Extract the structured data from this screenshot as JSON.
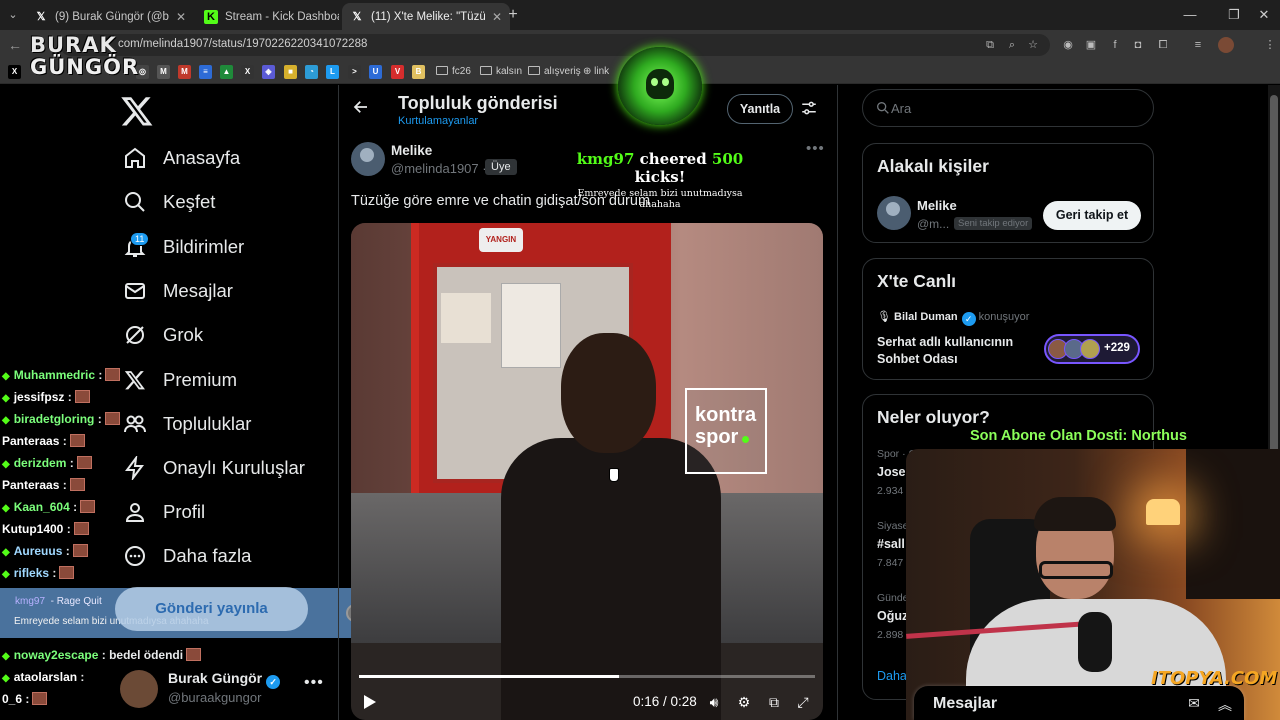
{
  "browser": {
    "tabs": [
      {
        "title": "(9) Burak Güngör (@buraakgungor)",
        "icon": "x-logo",
        "active": false
      },
      {
        "title": "Stream - Kick Dashboard",
        "icon": "kick-logo",
        "active": false
      },
      {
        "title": "(11) X'te Melike: \"Tüzüğe göre emre",
        "icon": "x-logo",
        "active": true
      }
    ],
    "url": "com/melinda1907/status/1970226220341072288",
    "bookmarks": [
      "fc26",
      "kalsın",
      "alışveriş",
      "link"
    ]
  },
  "overlay_logo": {
    "line1": "BURAK",
    "line2": "GÜNGÖR"
  },
  "nav": {
    "items": [
      {
        "label": "Anasayfa",
        "icon": "home-icon"
      },
      {
        "label": "Keşfet",
        "icon": "search-icon"
      },
      {
        "label": "Bildirimler",
        "icon": "bell-icon"
      },
      {
        "label": "Mesajlar",
        "icon": "mail-icon"
      },
      {
        "label": "Grok",
        "icon": "grok-icon"
      },
      {
        "label": "Premium",
        "icon": "x-icon"
      },
      {
        "label": "Topluluklar",
        "icon": "communities-icon"
      },
      {
        "label": "Onaylı Kuruluşlar",
        "icon": "lightning-icon"
      },
      {
        "label": "Profil",
        "icon": "user-icon"
      },
      {
        "label": "Daha fazla",
        "icon": "more-circle-icon"
      }
    ],
    "notif_count": "11",
    "post_button": "Gönderi yayınla"
  },
  "account": {
    "name": "Burak Güngör",
    "handle": "@buraakgungor",
    "more": "•••"
  },
  "stream_chat": {
    "lines": [
      {
        "user": "Muhammedric",
        "text": ":",
        "color": "#7cff7c",
        "diamond": true
      },
      {
        "user": "jessifpsz",
        "text": ":",
        "color": "#ffffff",
        "diamond": true
      },
      {
        "user": "biradetgloring",
        "text": ":",
        "color": "#7cff7c",
        "diamond": true
      },
      {
        "user": "Panteraas",
        "text": ":",
        "color": "#ffffff",
        "diamond": false
      },
      {
        "user": "derizdem",
        "text": ":",
        "color": "#7cff7c",
        "diamond": true
      },
      {
        "user": "Panteraas",
        "text": ":",
        "color": "#ffffff",
        "diamond": false
      },
      {
        "user": "Kaan_604",
        "text": ":",
        "color": "#7cff7c",
        "diamond": true
      },
      {
        "user": "Kutup1400",
        "text": ":",
        "color": "#ffffff",
        "diamond": false
      },
      {
        "user": "Aureuus",
        "text": ":",
        "color": "#a0d8ff",
        "diamond": true
      },
      {
        "user": "rifleks",
        "text": ":",
        "color": "#a0d8ff",
        "diamond": true
      }
    ],
    "lines_bottom": [
      {
        "user": "noway2escape",
        "text": ": bedel ödendi",
        "color": "#7cff7c",
        "diamond": true
      },
      {
        "user": "ataolarslan",
        "text": ":",
        "color": "#ffffff",
        "diamond": true
      },
      {
        "user": "0_6",
        "text": ":",
        "color": "#ffffff",
        "diamond": false
      }
    ],
    "alert": {
      "user": "kmg97",
      "separator": "-",
      "action": "Rage Quit",
      "message": "Emreyede selam bizi unutmadıysa ahahaha",
      "amount": "500"
    }
  },
  "cheer": {
    "user": "kmg97",
    "verb": "cheered",
    "amount": "500",
    "unit": "kicks!",
    "message": "Emreyede selam bizi unutmadıysa ahahaha"
  },
  "header": {
    "title": "Topluluk gönderisi",
    "subtitle": "Kurtulamayanlar",
    "reply": "Yanıtla"
  },
  "post": {
    "name": "Melike",
    "handle": "@melinda1907",
    "dot": "·",
    "member_badge": "Üye",
    "more": "•••",
    "text": "Tüzüğe göre emre ve chatin gidişat/son durum",
    "video": {
      "time": "0:16 / 0:28",
      "progress": 0.571,
      "logo_line1": "kontra",
      "logo_line2": "spor",
      "sign": "YANGIN"
    }
  },
  "right": {
    "search_placeholder": "Ara",
    "relevant": {
      "title": "Alakalı kişiler",
      "name": "Melike",
      "handle": "@m...",
      "follows_you": "Seni takip ediyor",
      "button": "Geri takip et"
    },
    "live": {
      "title": "X'te Canlı",
      "host": "Bilal Duman",
      "status": "konuşuyor",
      "space_title": "Serhat adlı kullanıcının Sohbet Odası",
      "listeners": "+229"
    },
    "trends": {
      "title": "Neler oluyor?",
      "items": [
        {
          "category": "Spor · Gündemdekiler",
          "name": "Jose M",
          "count": "2.934"
        },
        {
          "category": "Siyase",
          "name": "#sall",
          "count": "7.847"
        },
        {
          "category": "Günde",
          "name": "Oğuz",
          "count": "2.898"
        }
      ],
      "show_more": "Daha fazla göster"
    },
    "messages": "Mesajlar"
  },
  "stream_overlay": {
    "sub_text": "Son Abone Olan Dosti: Northus",
    "watermark": "ITOPYA.COM"
  }
}
